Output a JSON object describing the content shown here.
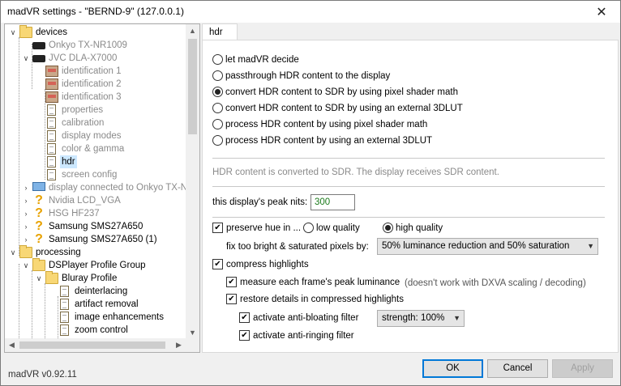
{
  "window": {
    "title": "madVR settings - \"BERND-9\" (127.0.0.1)",
    "version": "madVR v0.92.11"
  },
  "tree": {
    "items": [
      {
        "label": "devices",
        "icon": "folder-icon"
      },
      {
        "label": "Onkyo TX-NR1009",
        "icon": "device-icon"
      },
      {
        "label": "JVC DLA-X7000",
        "icon": "device-icon"
      },
      {
        "label": "identification 1",
        "icon": "identification-icon"
      },
      {
        "label": "identification 2",
        "icon": "identification-icon"
      },
      {
        "label": "identification 3",
        "icon": "identification-icon"
      },
      {
        "label": "properties",
        "icon": "page-icon"
      },
      {
        "label": "calibration",
        "icon": "page-icon"
      },
      {
        "label": "display modes",
        "icon": "page-icon"
      },
      {
        "label": "color & gamma",
        "icon": "page-icon"
      },
      {
        "label": "hdr",
        "icon": "page-icon"
      },
      {
        "label": "screen config",
        "icon": "page-icon"
      },
      {
        "label": "display connected to Onkyo TX-N",
        "icon": "monitor-icon"
      },
      {
        "label": "Nvidia LCD_VGA",
        "icon": "question-icon"
      },
      {
        "label": "HSG HF237",
        "icon": "question-icon"
      },
      {
        "label": "Samsung SMS27A650",
        "icon": "question-icon"
      },
      {
        "label": "Samsung SMS27A650 (1)",
        "icon": "question-icon"
      },
      {
        "label": "processing",
        "icon": "folder-icon"
      },
      {
        "label": "DSPlayer Profile Group",
        "icon": "folder-icon"
      },
      {
        "label": "Bluray Profile",
        "icon": "folder-icon"
      },
      {
        "label": "deinterlacing",
        "icon": "page-icon"
      },
      {
        "label": "artifact removal",
        "icon": "page-icon"
      },
      {
        "label": "image enhancements",
        "icon": "page-icon"
      },
      {
        "label": "zoom control",
        "icon": "page-icon"
      }
    ],
    "selected": "hdr"
  },
  "tab": {
    "label": "hdr"
  },
  "hdr": {
    "options": [
      {
        "label": "let madVR decide",
        "selected": false
      },
      {
        "label": "passthrough HDR content to the display",
        "selected": false
      },
      {
        "label": "convert HDR content to SDR by using pixel shader math",
        "selected": true
      },
      {
        "label": "convert HDR content to SDR by using an external 3DLUT",
        "selected": false
      },
      {
        "label": "process HDR content by using pixel shader math",
        "selected": false
      },
      {
        "label": "process HDR content by using an external 3DLUT",
        "selected": false
      }
    ],
    "info_text": "HDR content is converted to SDR. The display receives SDR content.",
    "peak_nits_label": "this display's peak nits:",
    "peak_nits_value": "300",
    "preserve_hue_label": "preserve hue in ...",
    "preserve_hue_checked": true,
    "quality_low_label": "low quality",
    "quality_high_label": "high quality",
    "quality_selected": "high quality",
    "fix_bright_label": "fix too bright & saturated pixels by:",
    "fix_bright_value": "50% luminance reduction and 50% saturation",
    "compress_highlights_label": "compress highlights",
    "measure_peak_label": "measure each frame's peak luminance",
    "measure_peak_note": "(doesn't work with DXVA scaling / decoding)",
    "restore_details_label": "restore details in compressed highlights",
    "anti_bloating_label": "activate anti-bloating filter",
    "strength_value": "strength: 100%",
    "anti_ringing_label": "activate anti-ringing filter"
  },
  "buttons": {
    "ok": "OK",
    "cancel": "Cancel",
    "apply": "Apply"
  },
  "colors": {
    "selection": "#cce8ff",
    "accent": "#0078d7",
    "nits_value": "#1a7a1a"
  }
}
